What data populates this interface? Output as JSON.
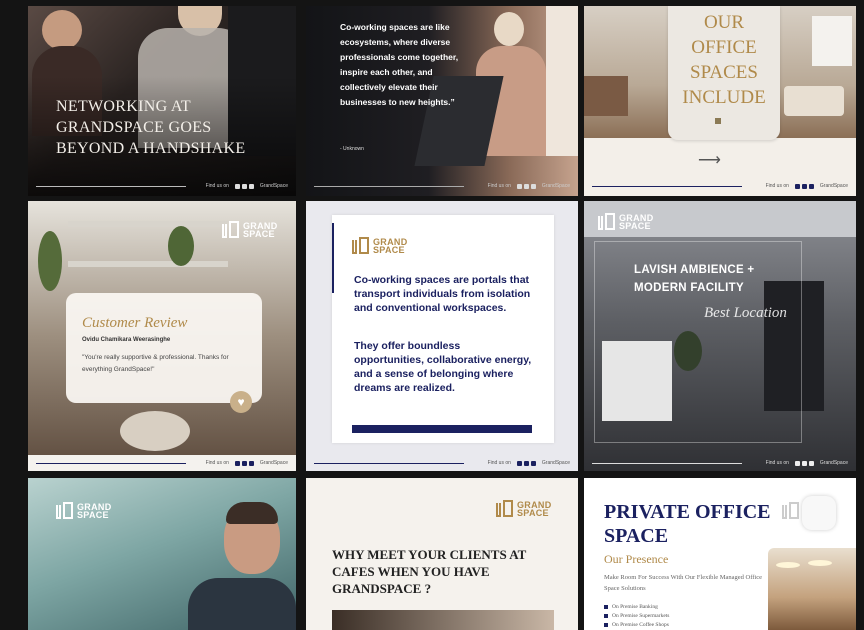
{
  "tiles": {
    "t1": {
      "headline": "NETWORKING AT GRANDSPACE GOES BEYOND A HANDSHAKE"
    },
    "t2": {
      "quote": "Co-working spaces are like ecosystems, where diverse professionals come together, inspire each other, and collectively elevate their businesses to new heights.”",
      "author": "- Unknown"
    },
    "t3": {
      "headline": "OUR OFFICE SPACES INCLUDE",
      "arrow": "⟶"
    },
    "t4": {
      "logo_line1": "GRAND",
      "logo_line2": "SPACE",
      "title": "Customer Review",
      "reviewer": "Ovidu Chamikara Weerasinghe",
      "review": "\"You're really supportive & professional. Thanks for everything GrandSpace!\"",
      "heart": "♥"
    },
    "t5": {
      "logo_line1": "GRAND",
      "logo_line2": "SPACE",
      "para1": "Co-working spaces are portals that transport individuals from isolation and conventional workspaces.",
      "para2": "They offer boundless opportunities, collaborative energy, and a sense of belonging where dreams are realized."
    },
    "t6": {
      "logo_line1": "GRAND",
      "logo_line2": "SPACE",
      "headline": "LAVISH AMBIENCE + MODERN FACILITY",
      "script": "Best Location"
    },
    "t7": {
      "logo_line1": "GRAND",
      "logo_line2": "SPACE"
    },
    "t8": {
      "logo_line1": "GRAND",
      "logo_line2": "SPACE",
      "headline": "WHY MEET YOUR CLIENTS AT CAFES WHEN YOU HAVE GRANDSPACE ?"
    },
    "t9": {
      "headline": "PRIVATE OFFICE SPACE",
      "subtitle": "Our Presence",
      "tagline": "Make Room For Success With Our Flexible Managed Office Space Solutions",
      "features": [
        "On Premise Banking",
        "On Premise Supermarkets",
        "On Premise Coffee Shops"
      ]
    }
  },
  "footer": {
    "find": "Find us on",
    "brand": "GrandSpace"
  },
  "colors": {
    "navy": "#1b2160",
    "gold": "#b08a4a",
    "dark": "#141414"
  }
}
